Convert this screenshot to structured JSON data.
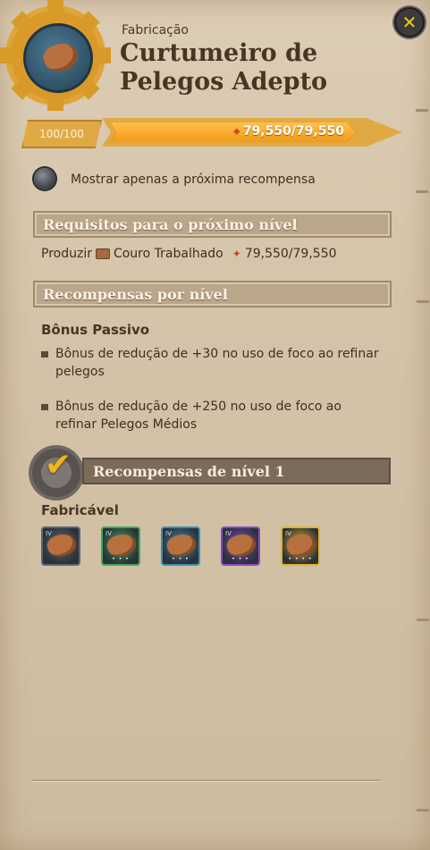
{
  "header": {
    "category": "Fabricação",
    "title": "Curtumeiro de Pelegos Adepto",
    "close_icon": "close-x-icon"
  },
  "progress": {
    "level_text": "100/100",
    "fame_text": "79,550/79,550",
    "fill_fraction": 1.0,
    "fame_icon": "fame-icon"
  },
  "toggle": {
    "label": "Mostrar apenas a próxima recompensa"
  },
  "requirements": {
    "header": "Requisitos para o próximo nível",
    "verb": "Produzir",
    "item": "Couro Trabalhado",
    "amount": "79,550/79,550"
  },
  "rewards_by_level": {
    "header": "Recompensas por nível",
    "passive_title": "Bônus Passivo",
    "bonuses": [
      "Bônus de redução de +30 no uso de foco ao refinar pelegos",
      "Bônus de redução de +250 no uso de foco ao refinar Pelegos Médios"
    ]
  },
  "level_reward": {
    "header": "Recompensas de nível 1",
    "craftable_title": "Fabricável",
    "items": [
      {
        "tier": "IV",
        "rarity_color": "#5c6673",
        "dots": ""
      },
      {
        "tier": "IV",
        "rarity_color": "#3fa85a",
        "dots": "• • •"
      },
      {
        "tier": "IV",
        "rarity_color": "#3a8fb0",
        "dots": "• • •"
      },
      {
        "tier": "IV",
        "rarity_color": "#8a49c9",
        "dots": "• • •"
      },
      {
        "tier": "IV",
        "rarity_color": "#e2b22a",
        "dots": "• • • •"
      }
    ]
  }
}
